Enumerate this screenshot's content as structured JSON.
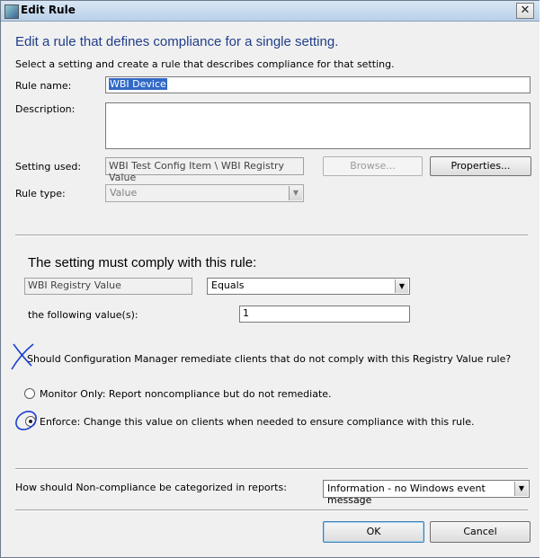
{
  "window": {
    "title": "Edit Rule",
    "close_glyph": "✕"
  },
  "header": {
    "heading": "Edit a rule that defines compliance for a single setting.",
    "subheading": "Select a setting and create a rule that describes compliance for that setting."
  },
  "form": {
    "rule_name_label": "Rule name:",
    "rule_name_value": "WBI Device",
    "description_label": "Description:",
    "description_value": "",
    "setting_used_label": "Setting used:",
    "setting_used_value": "WBI Test Config Item \\ WBI Registry Value",
    "browse_label": "Browse...",
    "properties_label": "Properties...",
    "rule_type_label": "Rule type:",
    "rule_type_value": "Value"
  },
  "rule": {
    "section_title": "The setting must comply with this rule:",
    "setting_name": "WBI Registry Value",
    "operator": "Equals",
    "values_label": "the following value(s):",
    "value": "1"
  },
  "remediation": {
    "question": "Should Configuration Manager remediate clients that do not comply with this Registry Value rule?",
    "option_monitor": "Monitor Only: Report noncompliance but do not remediate.",
    "option_enforce": "Enforce: Change this value on clients when needed to ensure compliance with this rule.",
    "selected": "enforce"
  },
  "reports": {
    "label": "How should Non-compliance be categorized in reports:",
    "severity": "Information - no Windows event message"
  },
  "footer": {
    "ok_label": "OK",
    "cancel_label": "Cancel"
  },
  "colors": {
    "heading": "#1f3e8a",
    "annotation": "#1a3fcf",
    "selection": "#3169c6"
  }
}
